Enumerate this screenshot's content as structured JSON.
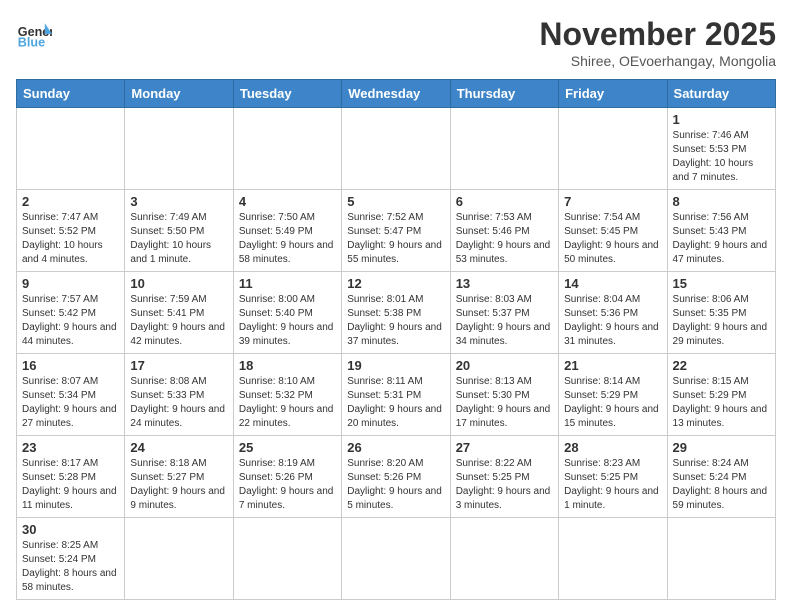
{
  "logo": {
    "text_general": "General",
    "text_blue": "Blue"
  },
  "header": {
    "title": "November 2025",
    "subtitle": "Shiree, OEvoerhangay, Mongolia"
  },
  "weekdays": [
    "Sunday",
    "Monday",
    "Tuesday",
    "Wednesday",
    "Thursday",
    "Friday",
    "Saturday"
  ],
  "weeks": [
    [
      {
        "day": "",
        "info": ""
      },
      {
        "day": "",
        "info": ""
      },
      {
        "day": "",
        "info": ""
      },
      {
        "day": "",
        "info": ""
      },
      {
        "day": "",
        "info": ""
      },
      {
        "day": "",
        "info": ""
      },
      {
        "day": "1",
        "info": "Sunrise: 7:46 AM\nSunset: 5:53 PM\nDaylight: 10 hours and 7 minutes."
      }
    ],
    [
      {
        "day": "2",
        "info": "Sunrise: 7:47 AM\nSunset: 5:52 PM\nDaylight: 10 hours and 4 minutes."
      },
      {
        "day": "3",
        "info": "Sunrise: 7:49 AM\nSunset: 5:50 PM\nDaylight: 10 hours and 1 minute."
      },
      {
        "day": "4",
        "info": "Sunrise: 7:50 AM\nSunset: 5:49 PM\nDaylight: 9 hours and 58 minutes."
      },
      {
        "day": "5",
        "info": "Sunrise: 7:52 AM\nSunset: 5:47 PM\nDaylight: 9 hours and 55 minutes."
      },
      {
        "day": "6",
        "info": "Sunrise: 7:53 AM\nSunset: 5:46 PM\nDaylight: 9 hours and 53 minutes."
      },
      {
        "day": "7",
        "info": "Sunrise: 7:54 AM\nSunset: 5:45 PM\nDaylight: 9 hours and 50 minutes."
      },
      {
        "day": "8",
        "info": "Sunrise: 7:56 AM\nSunset: 5:43 PM\nDaylight: 9 hours and 47 minutes."
      }
    ],
    [
      {
        "day": "9",
        "info": "Sunrise: 7:57 AM\nSunset: 5:42 PM\nDaylight: 9 hours and 44 minutes."
      },
      {
        "day": "10",
        "info": "Sunrise: 7:59 AM\nSunset: 5:41 PM\nDaylight: 9 hours and 42 minutes."
      },
      {
        "day": "11",
        "info": "Sunrise: 8:00 AM\nSunset: 5:40 PM\nDaylight: 9 hours and 39 minutes."
      },
      {
        "day": "12",
        "info": "Sunrise: 8:01 AM\nSunset: 5:38 PM\nDaylight: 9 hours and 37 minutes."
      },
      {
        "day": "13",
        "info": "Sunrise: 8:03 AM\nSunset: 5:37 PM\nDaylight: 9 hours and 34 minutes."
      },
      {
        "day": "14",
        "info": "Sunrise: 8:04 AM\nSunset: 5:36 PM\nDaylight: 9 hours and 31 minutes."
      },
      {
        "day": "15",
        "info": "Sunrise: 8:06 AM\nSunset: 5:35 PM\nDaylight: 9 hours and 29 minutes."
      }
    ],
    [
      {
        "day": "16",
        "info": "Sunrise: 8:07 AM\nSunset: 5:34 PM\nDaylight: 9 hours and 27 minutes."
      },
      {
        "day": "17",
        "info": "Sunrise: 8:08 AM\nSunset: 5:33 PM\nDaylight: 9 hours and 24 minutes."
      },
      {
        "day": "18",
        "info": "Sunrise: 8:10 AM\nSunset: 5:32 PM\nDaylight: 9 hours and 22 minutes."
      },
      {
        "day": "19",
        "info": "Sunrise: 8:11 AM\nSunset: 5:31 PM\nDaylight: 9 hours and 20 minutes."
      },
      {
        "day": "20",
        "info": "Sunrise: 8:13 AM\nSunset: 5:30 PM\nDaylight: 9 hours and 17 minutes."
      },
      {
        "day": "21",
        "info": "Sunrise: 8:14 AM\nSunset: 5:29 PM\nDaylight: 9 hours and 15 minutes."
      },
      {
        "day": "22",
        "info": "Sunrise: 8:15 AM\nSunset: 5:29 PM\nDaylight: 9 hours and 13 minutes."
      }
    ],
    [
      {
        "day": "23",
        "info": "Sunrise: 8:17 AM\nSunset: 5:28 PM\nDaylight: 9 hours and 11 minutes."
      },
      {
        "day": "24",
        "info": "Sunrise: 8:18 AM\nSunset: 5:27 PM\nDaylight: 9 hours and 9 minutes."
      },
      {
        "day": "25",
        "info": "Sunrise: 8:19 AM\nSunset: 5:26 PM\nDaylight: 9 hours and 7 minutes."
      },
      {
        "day": "26",
        "info": "Sunrise: 8:20 AM\nSunset: 5:26 PM\nDaylight: 9 hours and 5 minutes."
      },
      {
        "day": "27",
        "info": "Sunrise: 8:22 AM\nSunset: 5:25 PM\nDaylight: 9 hours and 3 minutes."
      },
      {
        "day": "28",
        "info": "Sunrise: 8:23 AM\nSunset: 5:25 PM\nDaylight: 9 hours and 1 minute."
      },
      {
        "day": "29",
        "info": "Sunrise: 8:24 AM\nSunset: 5:24 PM\nDaylight: 8 hours and 59 minutes."
      }
    ],
    [
      {
        "day": "30",
        "info": "Sunrise: 8:25 AM\nSunset: 5:24 PM\nDaylight: 8 hours and 58 minutes."
      },
      {
        "day": "",
        "info": ""
      },
      {
        "day": "",
        "info": ""
      },
      {
        "day": "",
        "info": ""
      },
      {
        "day": "",
        "info": ""
      },
      {
        "day": "",
        "info": ""
      },
      {
        "day": "",
        "info": ""
      }
    ]
  ]
}
